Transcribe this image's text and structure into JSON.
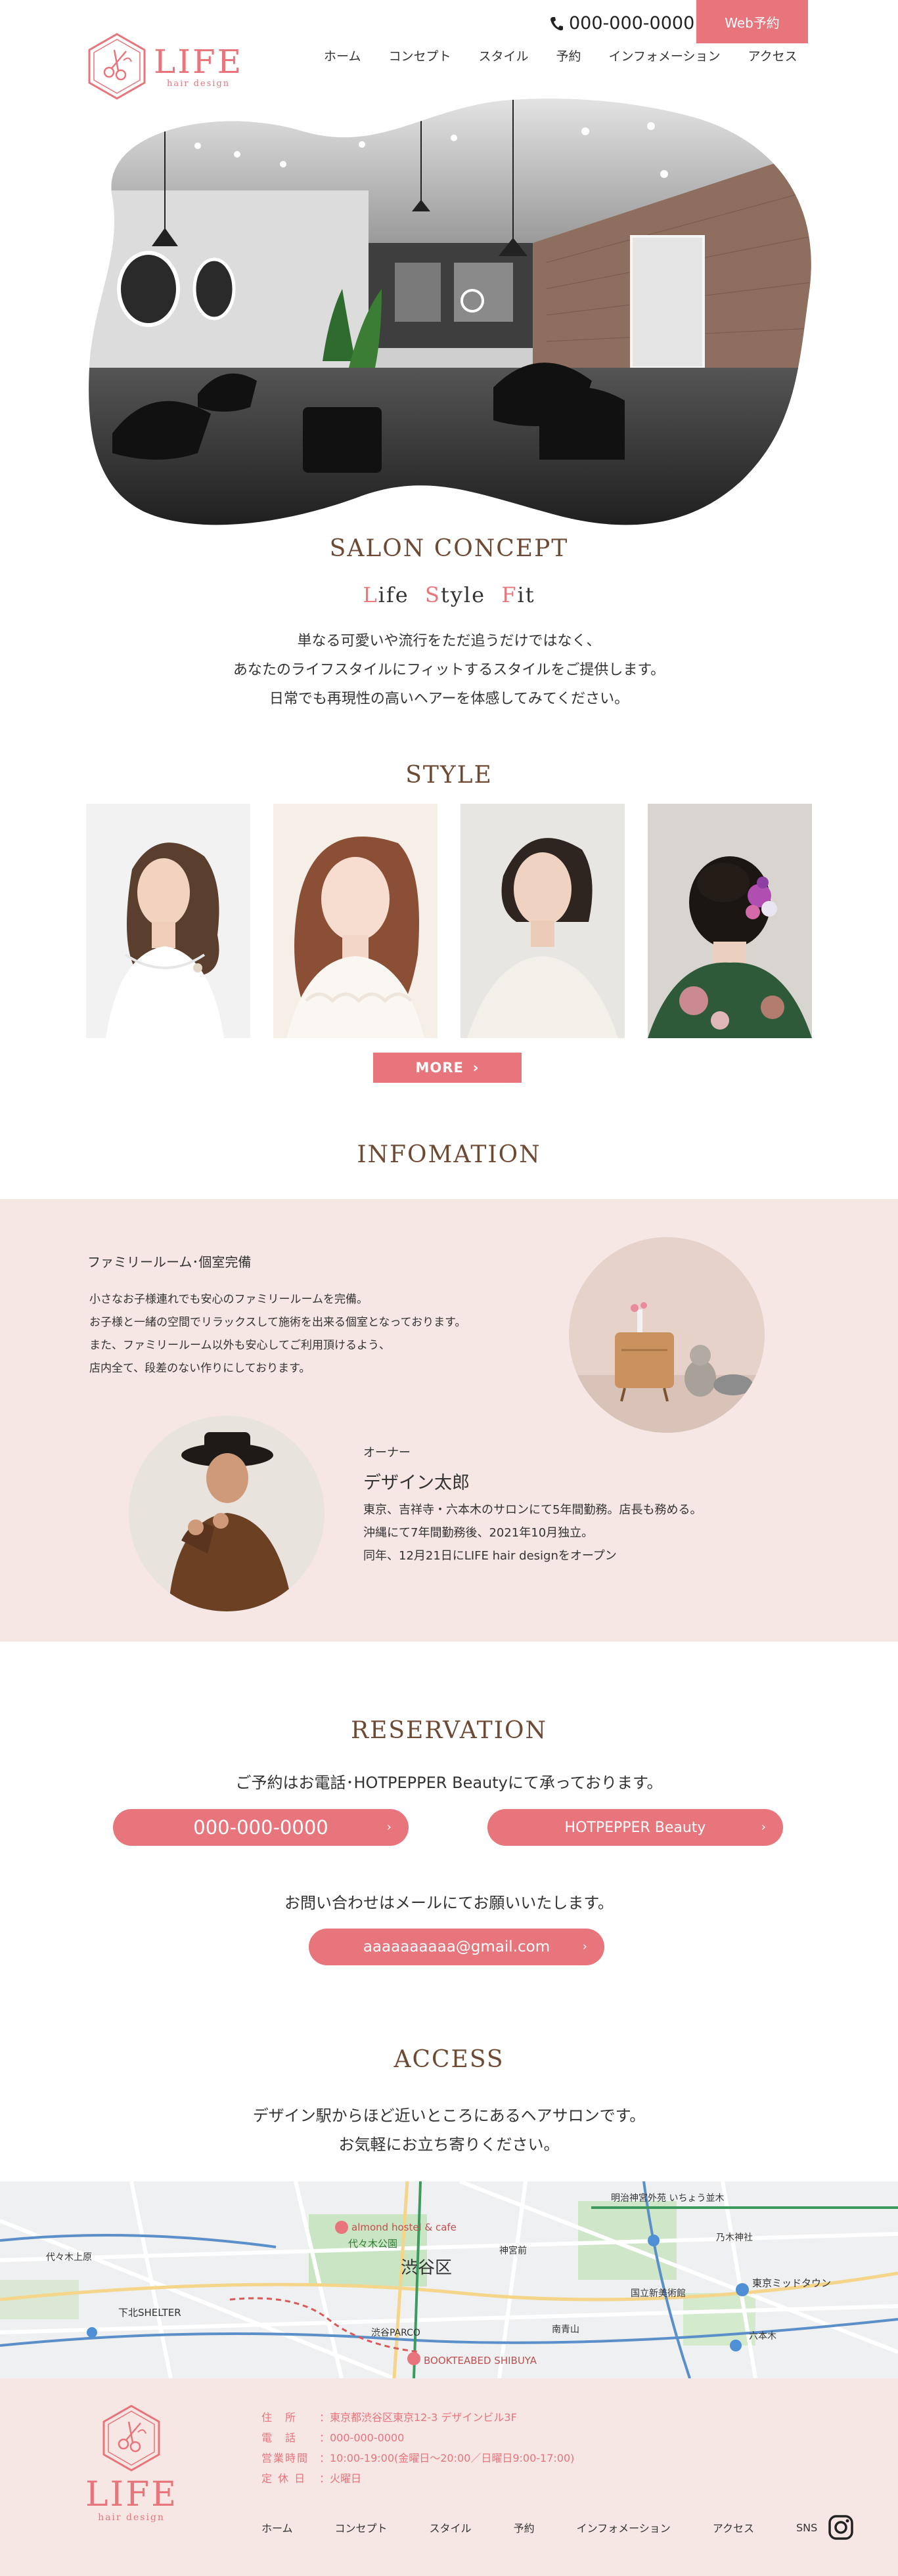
{
  "header": {
    "logo": {
      "word": "LIFE",
      "sub": "hair design"
    },
    "phone": "000-000-0000",
    "web_reserve": "Web予約",
    "nav": [
      "ホーム",
      "コンセプト",
      "スタイル",
      "予約",
      "インフォメーション",
      "アクセス"
    ]
  },
  "concept": {
    "title": "SALON CONCEPT",
    "tagline": [
      {
        "initial": "L",
        "rest": "ife"
      },
      {
        "initial": "S",
        "rest": "tyle"
      },
      {
        "initial": "F",
        "rest": "it"
      }
    ],
    "lines": [
      "単なる可愛いや流行をただ追うだけではなく、",
      "あなたのライフスタイルにフィットするスタイルをご提供します。",
      "日常でも再現性の高いヘアーを体感してみてください。"
    ]
  },
  "style": {
    "title": "STYLE",
    "more": "MORE"
  },
  "info": {
    "title": "INFOMATION",
    "heading": "ファミリールーム･個室完備",
    "body": [
      "小さなお子様連れでも安心のファミリールームを完備。",
      "お子様と一緒の空間でリラックスして施術を出来る個室となっております。",
      "また、ファミリールーム以外も安心してご利用頂けるよう、",
      "店内全て、段差のない作りにしております。"
    ],
    "owner_role": "オーナー",
    "owner_name": "デザイン太郎",
    "owner_body": [
      "東京、吉祥寺・六本木のサロンにて5年間勤務。店長も務める。",
      "沖縄にて7年間勤務後、2021年10月独立。",
      "同年、12月21日にLIFE hair designをオープン"
    ]
  },
  "reservation": {
    "title": "RESERVATION",
    "lead": "ご予約はお電話･HOTPEPPER Beautyにて承っております。",
    "tel": "000-000-0000",
    "hotpepper": "HOTPEPPER Beauty",
    "mail_lead": "お問い合わせはメールにてお願いいたします。",
    "mail": "aaaaaaaaaa@gmail.com"
  },
  "access": {
    "title": "ACCESS",
    "lines": [
      "デザイン駅からほど近いところにあるヘアサロンです。",
      "お気軽にお立ち寄りください。"
    ],
    "map_labels": {
      "district": "渋谷区",
      "shibuya_bridge": "BOOKTEABED SHIBUYA",
      "hostel": "almond hostel & cafe",
      "park": "代々木公園",
      "shelter": "下北SHELTER",
      "parco": "渋谷PARCO",
      "meiji": "明治神宮外苑 いちょう並木",
      "kokuritsu": "国立新美術館",
      "nogizaka": "乃木神社",
      "tokyo_midtown": "東京ミッドタウン",
      "jingu": "神宮前",
      "yoyogi_uehara": "代々木上原",
      "roppongi": "六本木",
      "aoyama": "南青山"
    }
  },
  "footer": {
    "logo": {
      "word": "LIFE",
      "sub": "hair design"
    },
    "info": [
      {
        "label": "住　所",
        "value": "：東京都渋谷区東京12-3 デザインビル3F"
      },
      {
        "label": "電　話",
        "value": "：000-000-0000"
      },
      {
        "label": "営業時間",
        "value": "：10:00-19:00(金曜日～20:00／日曜日9:00-17:00)"
      },
      {
        "label": "定 休 日",
        "value": "：火曜日"
      }
    ],
    "nav": [
      "ホーム",
      "コンセプト",
      "スタイル",
      "予約",
      "インフォメーション",
      "アクセス",
      "SNS"
    ]
  },
  "colors": {
    "accent": "#e8747c",
    "title_brown": "#6e4a34",
    "band": "#f6e6e4"
  },
  "icons": [
    "phone-icon",
    "chevron-right-icon",
    "instagram-icon",
    "scissors-logo-icon"
  ]
}
